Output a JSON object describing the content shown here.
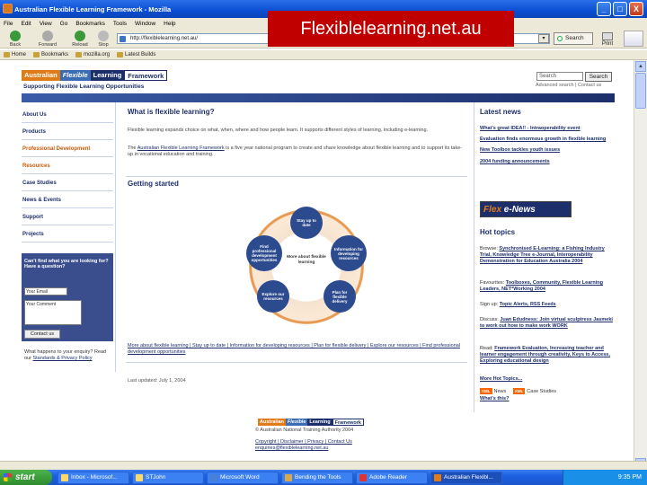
{
  "window": {
    "title": "Australian Flexible Learning Framework - Mozilla",
    "minimize": "_",
    "maximize": "□",
    "close": "X"
  },
  "overlay_label": "Flexiblelearning.net.au",
  "menu": [
    "File",
    "Edit",
    "View",
    "Go",
    "Bookmarks",
    "Tools",
    "Window",
    "Help"
  ],
  "toolbar": {
    "back": "Back",
    "forward": "Forward",
    "reload": "Reload",
    "stop": "Stop",
    "url": "http://flexiblelearning.net.au/",
    "search": "Search",
    "print": "Print"
  },
  "bookmarks": [
    "Home",
    "Bookmarks",
    "mozilla.org",
    "Latest Builds"
  ],
  "site": {
    "logo": {
      "a": "Australian",
      "b": "Flexible",
      "c": "Learning",
      "d": "Framework"
    },
    "tagline": "Supporting Flexible Learning Opportunities",
    "search_placeholder": "Search",
    "search_button": "Search",
    "toplinks": "Advanced search | Contact us"
  },
  "nav": [
    "About Us",
    "Products",
    "Professional Development",
    "Resources",
    "Case Studies",
    "News & Events",
    "Support",
    "Projects"
  ],
  "sidebox": {
    "question": "Can't find what you are looking for? Have a question?",
    "email_placeholder": "Your Email",
    "comment_placeholder": "Your Comment",
    "button": "Contact us"
  },
  "enquiry": {
    "text": "What happens to your enquiry? Read our",
    "link": "Standards & Privacy Policy"
  },
  "main": {
    "heading1": "What is flexible learning?",
    "para1": "Flexible learning expands choice on what, when, where and how people learn. It supports different styles of learning, including e-learning.",
    "para2_pre": "The",
    "para2_link": "Australian Flexible Learning Framework",
    "para2_post": "is a five year national program to create and share knowledge about flexible learning and to support its take-up in vocational education and training.",
    "heading2": "Getting started",
    "center": "More about flexible learning",
    "petals": {
      "top": "Stay up to date",
      "upper_left": "Find professional development opportunities",
      "upper_right": "Information for developing resources",
      "lower_left": "Explore our resources",
      "lower_right": "Plan for flexible delivery"
    },
    "links": "More about flexible learning | Stay up to date | Information for developing resources | Plan for flexible delivery | Explore our resources | Find professional development opportunities",
    "updated": "Last updated: July 1, 2004"
  },
  "news": {
    "heading": "Latest news",
    "items": [
      "What's great IDEA!! - Intraoperability event",
      "Evaluation finds enormous growth in flexible learning",
      "New Toolbox tackles youth issues",
      "2004 funding announcements"
    ],
    "banner_a": "Flex",
    "banner_b": "e-News"
  },
  "hot": {
    "heading": "Hot topics",
    "items": [
      {
        "label": "Browse:",
        "text": "Synchronised E-Learning: a Fishing Industry Trial, Knowledge Tree e-Journal, Interoperability Demonstration for Education Australia 2004"
      },
      {
        "label": "Favourites:",
        "text": "Toolboxes, Community, Flexible Learning Leaders, NET*Working 2004"
      },
      {
        "label": "Sign up:",
        "text": "Topic Alerts, RSS Feeds"
      },
      {
        "label": "Discuss:",
        "text": "Juan Edudness: Join virtual sculptress Jasmeki to work out how to make work WORK"
      },
      {
        "label": "Read:",
        "text": "Framework Evaluation, Increasing teacher and learner engagement through creativity, Keys to Access, Exploring educational design"
      }
    ],
    "more": "More Hot Topics...",
    "xml1": "XML",
    "xml1_label": "News",
    "xml2": "XML",
    "xml2_label": "Case Studies",
    "whatsthis": "What's this?"
  },
  "footer": {
    "copy": "© Australian National Training Authority 2004",
    "links": "Copyright | Disclaimer | Privacy | Contact Us",
    "email": "enquiries@flexiblelearning.net.au"
  },
  "taskbar": {
    "start": "start",
    "tasks": [
      "Inbox - Microsof...",
      "STJohn",
      "Microsoft Word",
      "Bending the Tools",
      "Adobe Reader",
      "Australian Flexibl..."
    ],
    "clock": "9:35 PM"
  }
}
